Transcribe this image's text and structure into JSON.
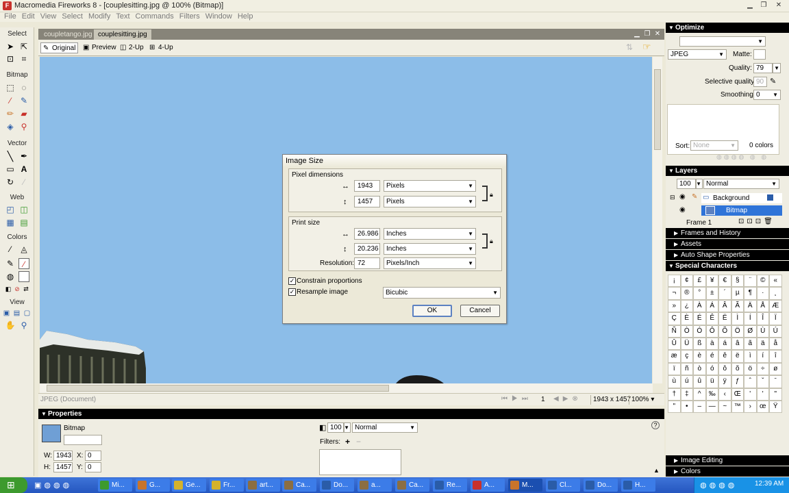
{
  "window": {
    "title": "Macromedia Fireworks 8 - [couplesitting.jpg @ 100% (Bitmap)]"
  },
  "menu": [
    "File",
    "Edit",
    "View",
    "Select",
    "Modify",
    "Text",
    "Commands",
    "Filters",
    "Window",
    "Help"
  ],
  "tools": {
    "select_heading": "Select",
    "bitmap_heading": "Bitmap",
    "vector_heading": "Vector",
    "web_heading": "Web",
    "colors_heading": "Colors",
    "view_heading": "View"
  },
  "document": {
    "tabs": [
      "coupletango.jpg",
      "couplesitting.jpg"
    ],
    "active_tab": "couplesitting.jpg",
    "view_tabs": [
      "Original",
      "Preview",
      "2-Up",
      "4-Up"
    ],
    "status_text": "JPEG (Document)",
    "frame_number": "1",
    "dimensions": "1943 x 1457",
    "zoom": "100%",
    "canvas_color": "#8cbde8"
  },
  "dialog": {
    "title": "Image Size",
    "pixel_dimensions_label": "Pixel dimensions",
    "pixel_width": "1943",
    "pixel_height": "1457",
    "pixel_unit_w": "Pixels",
    "pixel_unit_h": "Pixels",
    "print_size_label": "Print size",
    "print_width": "26.986",
    "print_height": "20.236",
    "print_unit_w": "Inches",
    "print_unit_h": "Inches",
    "resolution_label": "Resolution:",
    "resolution_value": "72",
    "resolution_unit": "Pixels/Inch",
    "constrain_label": "Constrain proportions",
    "resample_label": "Resample image",
    "resample_method": "Bicubic",
    "ok_label": "OK",
    "cancel_label": "Cancel"
  },
  "optimize": {
    "header": "Optimize",
    "format": "JPEG",
    "matte_label": "Matte:",
    "quality_label": "Quality:",
    "quality_value": "79",
    "selective_label": "Selective quality:",
    "selective_value": "90",
    "smoothing_label": "Smoothing:",
    "smoothing_value": "0",
    "sort_label": "Sort:",
    "sort_value": "None",
    "colors_count": "0 colors"
  },
  "layers": {
    "header": "Layers",
    "opacity": "100",
    "blend": "Normal",
    "layer_name": "Background",
    "object_name": "Bitmap",
    "frame_label": "Frame 1"
  },
  "collapsed_panels": [
    "Frames and History",
    "Assets",
    "Auto Shape Properties"
  ],
  "special_chars": {
    "header": "Special Characters",
    "chars": [
      "¡",
      "¢",
      "£",
      "¥",
      "€",
      "§",
      "¨",
      "©",
      "«",
      "¬",
      "®",
      "°",
      "±",
      "´",
      "µ",
      "¶",
      "·",
      "¸",
      "»",
      "¿",
      "À",
      "Á",
      "Â",
      "Ã",
      "Ä",
      "Å",
      "Æ",
      "Ç",
      "È",
      "É",
      "Ê",
      "Ë",
      "Ì",
      "Í",
      "Î",
      "Ï",
      "Ñ",
      "Ò",
      "Ó",
      "Ô",
      "Õ",
      "Ö",
      "Ø",
      "Ù",
      "Ú",
      "Û",
      "Ü",
      "ß",
      "à",
      "á",
      "â",
      "ã",
      "ä",
      "å",
      "æ",
      "ç",
      "è",
      "é",
      "ê",
      "ë",
      "ì",
      "í",
      "î",
      "ï",
      "ñ",
      "ò",
      "ó",
      "ô",
      "õ",
      "ö",
      "÷",
      "ø",
      "ù",
      "ú",
      "û",
      "ü",
      "ÿ",
      "ƒ",
      "ˆ",
      "ˇ",
      "ˉ",
      "†",
      "‡",
      "^",
      "‰",
      "‹",
      "Œ",
      "'",
      "'",
      "\"",
      "\"",
      "•",
      "–",
      "—",
      "~",
      "™",
      "›",
      "œ",
      "Ÿ"
    ]
  },
  "bottom_panels": [
    "Image Editing",
    "Colors"
  ],
  "properties": {
    "header": "Properties",
    "object_type": "Bitmap",
    "w_label": "W:",
    "w_value": "1943",
    "h_label": "H:",
    "h_value": "1457",
    "x_label": "X:",
    "x_value": "0",
    "y_label": "Y:",
    "y_value": "0",
    "opacity": "100",
    "blend": "Normal",
    "filters_label": "Filters:"
  },
  "taskbar": {
    "buttons": [
      "Mi...",
      "G...",
      "Ge...",
      "Fr...",
      "art...",
      "Ca...",
      "Do...",
      "a...",
      "Ca...",
      "Re...",
      "A...",
      "M...",
      "Cl...",
      "Do...",
      "H..."
    ],
    "clock": "12:39 AM"
  }
}
